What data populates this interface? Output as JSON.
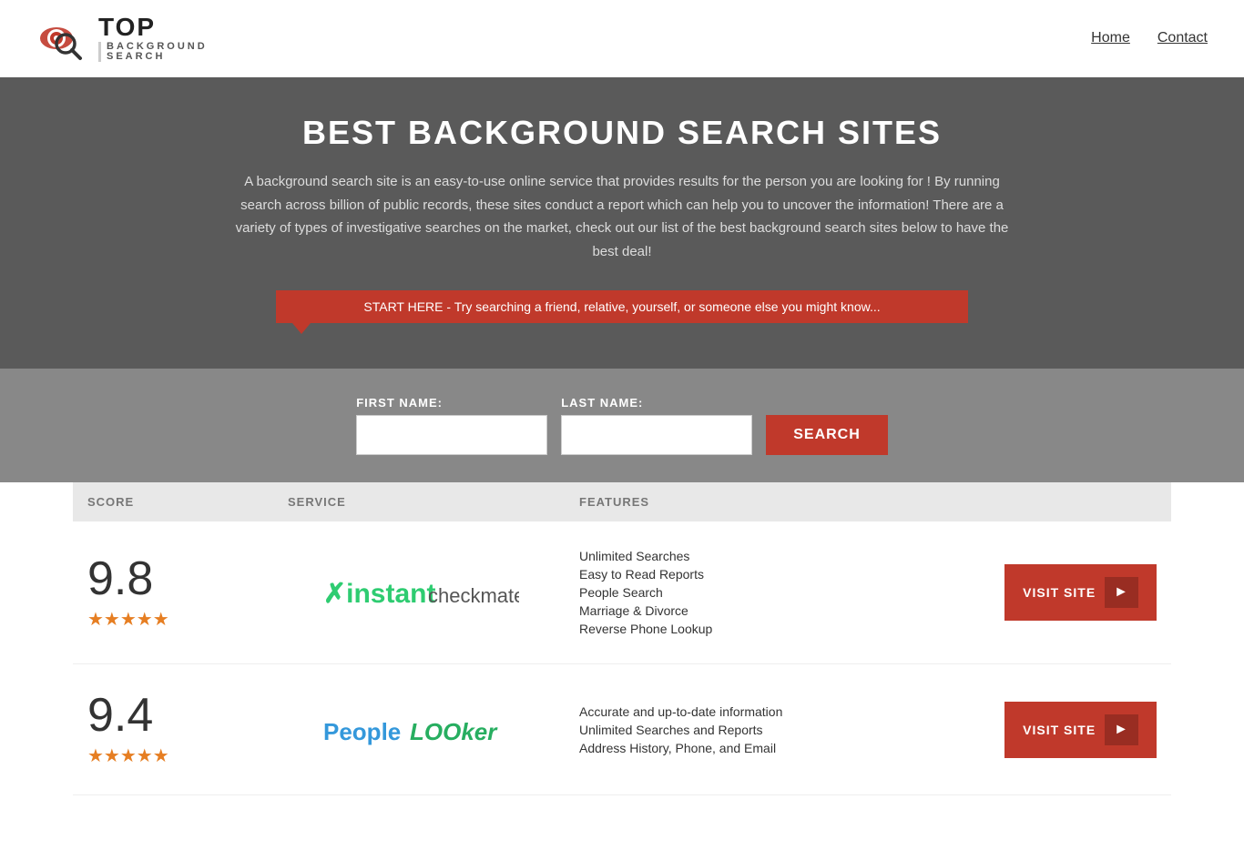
{
  "header": {
    "logo_top": "TOP",
    "logo_bottom": "BACKGROUND\nSEARCH",
    "nav": {
      "home": "Home",
      "contact": "Contact"
    }
  },
  "hero": {
    "title": "BEST BACKGROUND SEARCH SITES",
    "description": "A background search site is an easy-to-use online service that provides results  for the person you are looking for ! By  running  search across billion of public records, these sites conduct  a report which can help you to uncover the information! There are a variety of types of investigative searches on the market, check out our  list of the best background search sites below to have the best deal!",
    "callout": "START HERE - Try searching a friend, relative, yourself, or someone else you might know..."
  },
  "search_form": {
    "first_name_label": "FIRST NAME:",
    "last_name_label": "LAST NAME:",
    "first_name_placeholder": "",
    "last_name_placeholder": "",
    "button_label": "SEARCH"
  },
  "table": {
    "headers": {
      "score": "SCORE",
      "service": "SERVICE",
      "features": "FEATURES"
    },
    "rows": [
      {
        "score": "9.8",
        "stars": "★★★★★",
        "service_name": "Instant Checkmate",
        "features": [
          "Unlimited Searches",
          "Easy to Read Reports",
          "People Search",
          "Marriage & Divorce",
          "Reverse Phone Lookup"
        ],
        "visit_label": "VISIT SITE"
      },
      {
        "score": "9.4",
        "stars": "★★★★★",
        "service_name": "PeopleLooker",
        "features": [
          "Accurate and up-to-date information",
          "Unlimited Searches and Reports",
          "Address History, Phone, and Email"
        ],
        "visit_label": "VISIT SITE"
      }
    ]
  }
}
